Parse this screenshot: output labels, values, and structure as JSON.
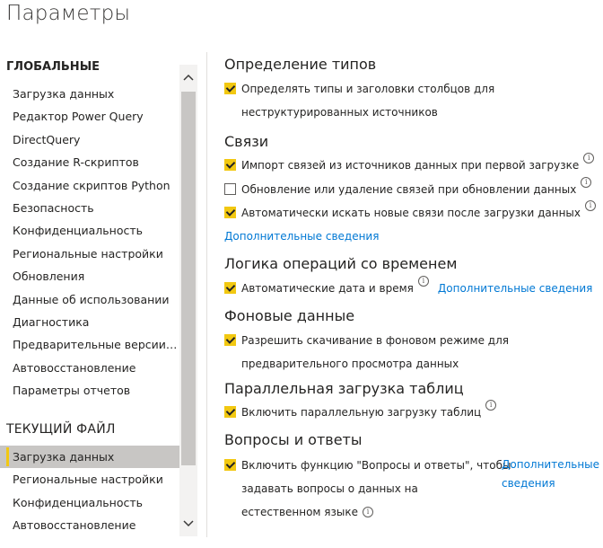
{
  "title": "Параметры",
  "sidebar": {
    "global_header": "ГЛОБАЛЬНЫЕ",
    "global_items": [
      "Загрузка данных",
      "Редактор Power Query",
      "DirectQuery",
      "Создание R-скриптов",
      "Создание скриптов Python",
      "Безопасность",
      "Конфиденциальность",
      "Региональные настройки",
      "Обновления",
      "Данные об использовании",
      "Диагностика",
      "Предварительные версии во...",
      "Автовосстановление",
      "Параметры отчетов"
    ],
    "current_header": "ТЕКУЩИЙ ФАЙЛ",
    "current_items": [
      "Загрузка данных",
      "Региональные настройки",
      "Конфиденциальность",
      "Автовосстановление"
    ],
    "selected_section": "current",
    "selected_index": 0
  },
  "main": {
    "type_detection": {
      "title": "Определение типов",
      "option1_line1": "Определять типы и заголовки столбцов для",
      "option1_line2": "неструктурированных источников",
      "option1_checked": true
    },
    "relationships": {
      "title": "Связи",
      "option1": "Импорт связей из источников данных при первой загрузке",
      "option1_checked": true,
      "option2": "Обновление или удаление связей при обновлении данных",
      "option2_checked": false,
      "option3": "Автоматически искать новые связи после загрузки данных",
      "option3_checked": true,
      "learn_more": "Дополнительные сведения"
    },
    "time_intelligence": {
      "title": "Логика операций со временем",
      "option1": "Автоматические дата и время",
      "option1_checked": true,
      "learn_more": "Дополнительные сведения"
    },
    "background_data": {
      "title": "Фоновые данные",
      "option1_line1": "Разрешить скачивание в фоновом режиме для",
      "option1_line2": "предварительного просмотра данных",
      "option1_checked": true
    },
    "parallel_loading": {
      "title": "Параллельная загрузка таблиц",
      "option1": "Включить параллельную загрузку таблиц",
      "option1_checked": true
    },
    "qna": {
      "title": "Вопросы и ответы",
      "option1_line1": "Включить функцию \"Вопросы и ответы\", чтобы",
      "option1_line2": "задавать вопросы о данных на",
      "option1_line3": "естественном языке",
      "option1_checked": true,
      "learn_more_line1": "Дополнительные",
      "learn_more_line2": "сведения"
    },
    "info_glyph": "i"
  },
  "colors": {
    "accent": "#f2c811",
    "link": "#0078d4",
    "selected_bg": "#c8c6c4"
  }
}
